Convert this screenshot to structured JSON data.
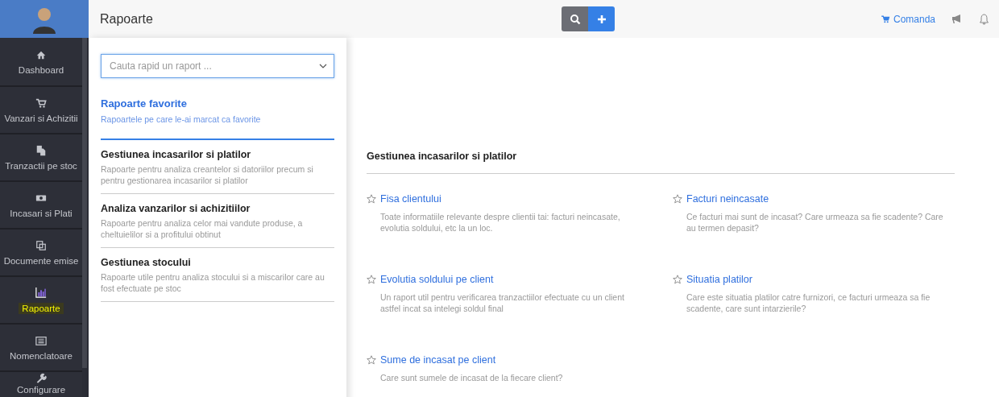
{
  "header": {
    "title": "Rapoarte",
    "order_link": "Comanda"
  },
  "sidebar": {
    "items": [
      {
        "label": "Dashboard",
        "selected": false
      },
      {
        "label": "Vanzari si Achizitii",
        "selected": false
      },
      {
        "label": "Tranzactii pe stoc",
        "selected": false
      },
      {
        "label": "Incasari si Plati",
        "selected": false
      },
      {
        "label": "Documente emise",
        "selected": false
      },
      {
        "label": "Rapoarte",
        "selected": true
      },
      {
        "label": "Nomenclatoare",
        "selected": false
      },
      {
        "label": "Configurare",
        "selected": false
      }
    ]
  },
  "search": {
    "placeholder": "Cauta rapid un raport ..."
  },
  "favorites": {
    "title": "Rapoarte favorite",
    "description": "Rapoartele pe care le-ai marcat ca favorite"
  },
  "categories": [
    {
      "title": "Gestiunea incasarilor si platilor",
      "description": "Rapoarte pentru analiza creantelor si datoriilor precum si pentru gestionarea incasarilor si platilor"
    },
    {
      "title": "Analiza vanzarilor si achizitiilor",
      "description": "Rapoarte pentru analiza celor mai vandute produse, a cheltuielilor si a profitului obtinut"
    },
    {
      "title": "Gestiunea stocului",
      "description": "Rapoarte utile pentru analiza stocului si a miscarilor care au fost efectuate pe stoc"
    }
  ],
  "section": {
    "title": "Gestiunea incasarilor si platilor",
    "reports": [
      {
        "title": "Fisa clientului",
        "description": "Toate informatiile relevante despre clientii tai: facturi neincasate, evolutia soldului, etc la un loc.",
        "favorite": false
      },
      {
        "title": "Facturi neincasate",
        "description": "Ce facturi mai sunt de incasat? Care urmeaza sa fie scadente? Care au termen depasit?",
        "favorite": false
      },
      {
        "title": "Evolutia soldului pe client",
        "description": "Un raport util pentru verificarea tranzactiilor efectuate cu un client astfel incat sa intelegi soldul final",
        "favorite": false
      },
      {
        "title": "Situatia platilor",
        "description": "Care este situatia platilor catre furnizori, ce facturi urmeaza sa fie scadente, care sunt intarzierile?",
        "favorite": false
      },
      {
        "title": "Sume de incasat pe client",
        "description": "Care sunt sumele de incasat de la fiecare client?",
        "favorite": false
      }
    ]
  }
}
